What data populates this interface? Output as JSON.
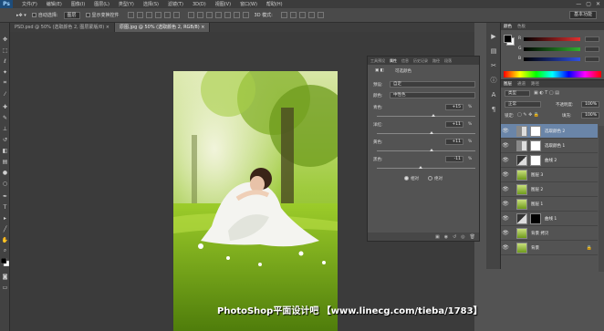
{
  "app": {
    "logo": "Ps",
    "window_controls": [
      "—",
      "▢",
      "✕"
    ]
  },
  "menu": [
    "文件(F)",
    "编辑(E)",
    "图像(I)",
    "图层(L)",
    "类型(Y)",
    "选择(S)",
    "滤镜(T)",
    "3D(D)",
    "视图(V)",
    "窗口(W)",
    "帮助(H)"
  ],
  "options": {
    "auto_select": "自动选择:",
    "auto_select_value": "图层",
    "show_transform": "显示变换控件",
    "mode_3d": "3D 模式:",
    "workspace": "基本功能"
  },
  "doc_tabs": [
    {
      "label": "PSD.psd @ 50% (选取颜色 2, 图层蒙版/8) ×",
      "active": false
    },
    {
      "label": "原图.jpg @ 50% (选取颜色 2, RGB/8) ×",
      "active": true
    }
  ],
  "properties": {
    "tabs": [
      "工具预设",
      "属性",
      "信息",
      "历史记录",
      "路径",
      "段落",
      "动作"
    ],
    "active_tab": "属性",
    "title": "可选颜色",
    "preset_label": "预设:",
    "preset_value": "自定",
    "colors_label": "颜色:",
    "colors_value": "中性色",
    "sliders": [
      {
        "label": "青色:",
        "value": "+15",
        "pct": 0.575
      },
      {
        "label": "洋红:",
        "value": "+11",
        "pct": 0.555
      },
      {
        "label": "黄色:",
        "value": "+11",
        "pct": 0.555
      },
      {
        "label": "黑色:",
        "value": "-11",
        "pct": 0.445
      }
    ],
    "unit": "%",
    "method_relative": "相对",
    "method_absolute": "绝对",
    "selected_method": "relative"
  },
  "color_panel": {
    "tabs": [
      "颜色",
      "色板"
    ],
    "channels": [
      {
        "label": "R",
        "value": "",
        "color": "#e03030"
      },
      {
        "label": "G",
        "value": "",
        "color": "#30b030"
      },
      {
        "label": "B",
        "value": "",
        "color": "#3050e0"
      }
    ],
    "foreground": "#000000",
    "background": "#ffffff"
  },
  "layers_panel": {
    "tabs": [
      "图层",
      "通道",
      "路径"
    ],
    "kind": "类型",
    "blend_mode": "正常",
    "opacity_label": "不透明度:",
    "opacity": "100%",
    "lock_label": "锁定:",
    "fill_label": "填充:",
    "fill": "100%",
    "layers": [
      {
        "name": "选取颜色 2",
        "thumb": "adjust",
        "mask": "white",
        "selected": true
      },
      {
        "name": "选取颜色 1",
        "thumb": "adjust",
        "mask": "white",
        "selected": false
      },
      {
        "name": "曲线 2",
        "thumb": "curve",
        "mask": "white",
        "selected": false
      },
      {
        "name": "图层 3",
        "thumb": "photo",
        "mask": "",
        "selected": false
      },
      {
        "name": "图层 2",
        "thumb": "photo",
        "mask": "",
        "selected": false
      },
      {
        "name": "图层 1",
        "thumb": "photo",
        "mask": "",
        "selected": false
      },
      {
        "name": "曲线 1",
        "thumb": "curve",
        "mask": "black",
        "selected": false
      },
      {
        "name": "背景 拷贝",
        "thumb": "photo",
        "mask": "",
        "selected": false
      },
      {
        "name": "背景",
        "thumb": "photo",
        "mask": "",
        "selected": false,
        "locked": true
      }
    ]
  },
  "watermark": "PhotoShop平面设计吧 【www.linecg.com/tieba/1783】"
}
